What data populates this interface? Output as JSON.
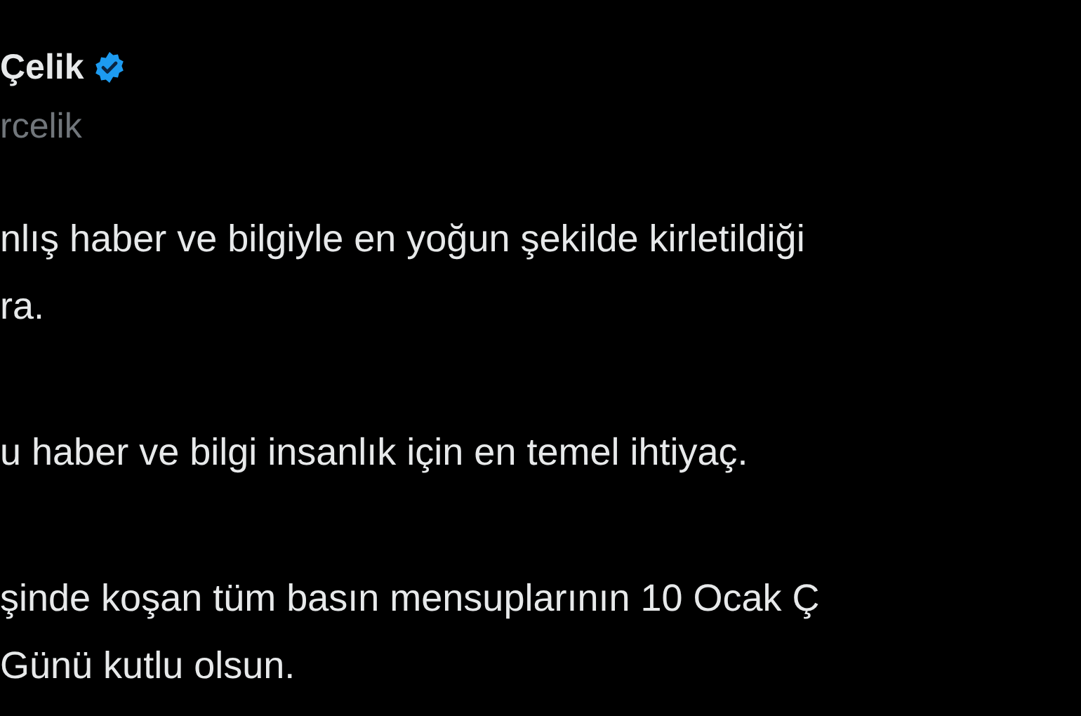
{
  "author": {
    "name": "Çelik",
    "verified": true,
    "handle": "rcelik"
  },
  "paragraphs": [
    {
      "lines": [
        "nlış haber ve bilgiyle en yoğun şekilde kirletildiği",
        "ra."
      ]
    },
    {
      "lines": [
        "u haber ve bilgi insanlık için en temel ihtiyaç."
      ]
    },
    {
      "lines": [
        "şinde koşan tüm basın mensuplarının 10 Ocak Ç",
        "Günü kutlu olsun."
      ]
    }
  ]
}
